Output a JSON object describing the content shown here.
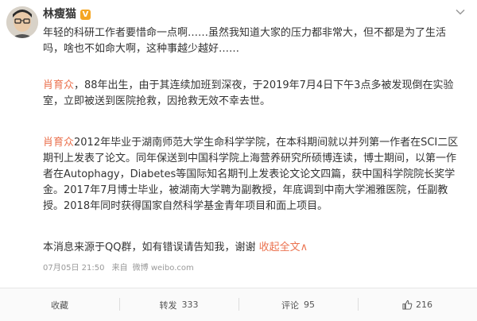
{
  "author": {
    "name": "林瘦猫",
    "badge": "V"
  },
  "post": {
    "intro": "年轻的科研工作者要惜命一点啊……虽然我知道大家的压力都非常大，但不都是为了生活吗，啥也不如命大啊，这种事越少越好……",
    "para2_name": "肖育众",
    "para2_text": "，88年出生，由于其连续加班到深夜，于2019年7月4日下午3点多被发现倒在实验室，立即被送到医院抢救，因抢救无效不幸去世。",
    "para3_name": "肖育众",
    "para3_text": "2012年毕业于湖南师范大学生命科学学院，在本科期间就以并列第一作者在SCI二区期刊上发表了论文。同年保送到中国科学院上海营养研究所硕博连读，博士期间，以第一作者在Autophagy，Diabetes等国际知名期刊上发表论文论文四篇，获中国科学院院长奖学金。2017年7月博士毕业，被湖南大学聘为副教授，年底调到中南大学湘雅医院，任副教授。2018年同时获得国家自然科学基金青年项目和面上项目。",
    "para4_text": "本消息来源于QQ群，如有错误请告知我，谢谢",
    "collapse_label": "收起全文",
    "collapse_arrow": "∧"
  },
  "meta": {
    "time": "07月05日 21:50",
    "source_prefix": "来自",
    "source": "微博 weibo.com"
  },
  "actions": {
    "favorite_label": "收藏",
    "repost_label": "转发",
    "repost_count": "333",
    "comment_label": "评论",
    "comment_count": "95",
    "like_count": "216"
  },
  "colors": {
    "accent": "#eb7350",
    "vip_badge": "#f5a623"
  },
  "icons": {
    "more": "chevron-down-icon",
    "like": "thumbs-up-icon",
    "verified": "vip-badge-icon"
  }
}
